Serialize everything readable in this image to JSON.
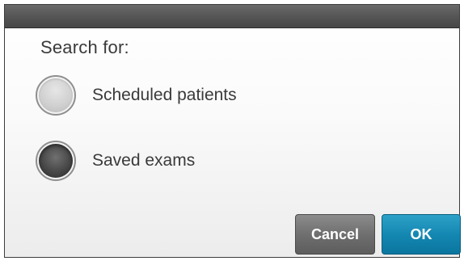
{
  "dialog": {
    "heading": "Search for:",
    "options": [
      {
        "label": "Scheduled patients",
        "selected": false
      },
      {
        "label": "Saved exams",
        "selected": true
      }
    ],
    "buttons": {
      "cancel_label": "Cancel",
      "ok_label": "OK"
    }
  },
  "colors": {
    "title_bar": "#565656",
    "cancel_button": "#6f6f6f",
    "ok_button": "#1488b2",
    "text": "#3a3a3a"
  }
}
